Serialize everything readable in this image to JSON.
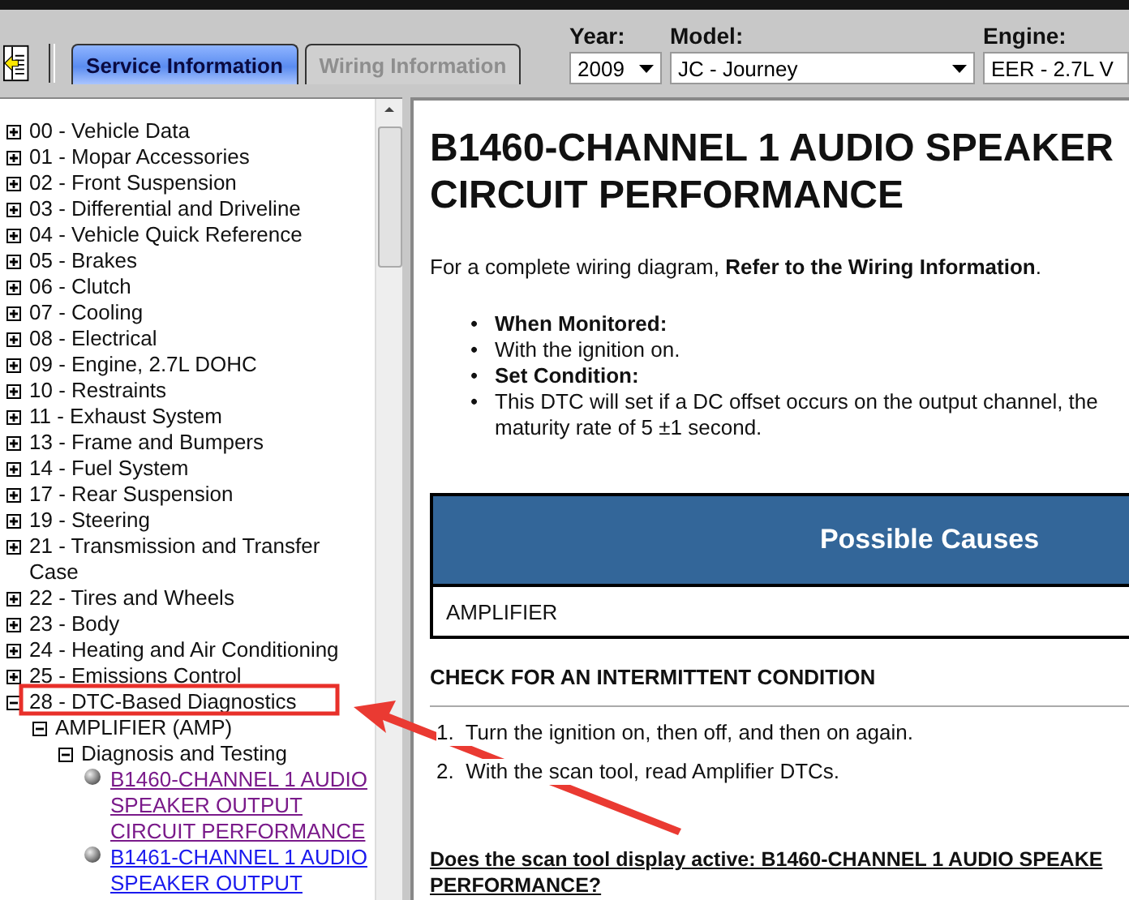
{
  "toolbar": {
    "tabs": [
      {
        "label": "Service Information",
        "selected": true,
        "disabled": false
      },
      {
        "label": "Wiring Information",
        "selected": false,
        "disabled": true
      }
    ],
    "filters": [
      {
        "label": "Year:",
        "value": "2009",
        "kind": "dropdown"
      },
      {
        "label": "Model:",
        "value": "JC - Journey",
        "kind": "dropdown"
      },
      {
        "label": "Engine:",
        "value": "EER - 2.7L V",
        "kind": "cut"
      }
    ]
  },
  "tree": [
    {
      "label": "00 - Vehicle Data",
      "expanded": false
    },
    {
      "label": "01 - Mopar Accessories",
      "expanded": false
    },
    {
      "label": "02 - Front Suspension",
      "expanded": false
    },
    {
      "label": "03 - Differential and Driveline",
      "expanded": false
    },
    {
      "label": "04 - Vehicle Quick Reference",
      "expanded": false
    },
    {
      "label": "05 - Brakes",
      "expanded": false
    },
    {
      "label": "06 - Clutch",
      "expanded": false
    },
    {
      "label": "07 - Cooling",
      "expanded": false
    },
    {
      "label": "08 - Electrical",
      "expanded": false
    },
    {
      "label": "09 - Engine, 2.7L DOHC",
      "expanded": false
    },
    {
      "label": "10 - Restraints",
      "expanded": false
    },
    {
      "label": "11 - Exhaust System",
      "expanded": false
    },
    {
      "label": "13 - Frame and Bumpers",
      "expanded": false
    },
    {
      "label": "14 - Fuel System",
      "expanded": false
    },
    {
      "label": "17 - Rear Suspension",
      "expanded": false
    },
    {
      "label": "19 - Steering",
      "expanded": false
    },
    {
      "label": "21 - Transmission and Transfer Case",
      "expanded": false
    },
    {
      "label": "22 - Tires and Wheels",
      "expanded": false
    },
    {
      "label": "23 - Body",
      "expanded": false
    },
    {
      "label": "24 - Heating and Air Conditioning",
      "expanded": false
    },
    {
      "label": "25 - Emissions Control",
      "expanded": false
    },
    {
      "label": "28 - DTC-Based Diagnostics",
      "expanded": true,
      "children": [
        {
          "label": "AMPLIFIER (AMP)",
          "expanded": true,
          "children": [
            {
              "label": "Diagnosis and Testing",
              "expanded": true,
              "children": [
                {
                  "label": "B1460-CHANNEL 1 AUDIO SPEAKER OUTPUT CIRCUIT PERFORMANCE",
                  "kind": "link",
                  "visited": true
                },
                {
                  "label": "B1461-CHANNEL 1 AUDIO SPEAKER OUTPUT",
                  "kind": "link",
                  "visited": false
                }
              ]
            }
          ]
        }
      ]
    }
  ],
  "article": {
    "title_lines": [
      "B1460-CHANNEL 1 AUDIO SPEAKER",
      "CIRCUIT PERFORMANCE"
    ],
    "intro": "For a complete wiring diagram, **Refer to the Wiring Information**.",
    "conditions": [
      {
        "kind": "heading",
        "marker": "•",
        "lines": [
          "When Monitored:"
        ]
      },
      {
        "kind": "detail",
        "marker": "•",
        "lines": [
          "With the ignition on."
        ]
      },
      {
        "kind": "heading",
        "marker": "•",
        "lines": [
          "Set Condition:"
        ]
      },
      {
        "kind": "detail",
        "marker": "•",
        "lines": [
          "This DTC will set if a DC offset occurs on the output channel, the",
          "maturity rate of 5 ±1 second."
        ]
      }
    ],
    "causes_table": {
      "header": "Possible Causes",
      "rows": [
        "AMPLIFIER"
      ]
    },
    "check_heading": "CHECK FOR AN INTERMITTENT CONDITION",
    "steps": [
      {
        "number": "1.",
        "text": "Turn the ignition on, then off, and then on again."
      },
      {
        "number": "2.",
        "text": "With the scan tool, read Amplifier DTCs."
      }
    ],
    "question_lines": [
      "Does the scan tool display active: B1460-CHANNEL 1 AUDIO SPEAKE",
      "PERFORMANCE?"
    ]
  }
}
